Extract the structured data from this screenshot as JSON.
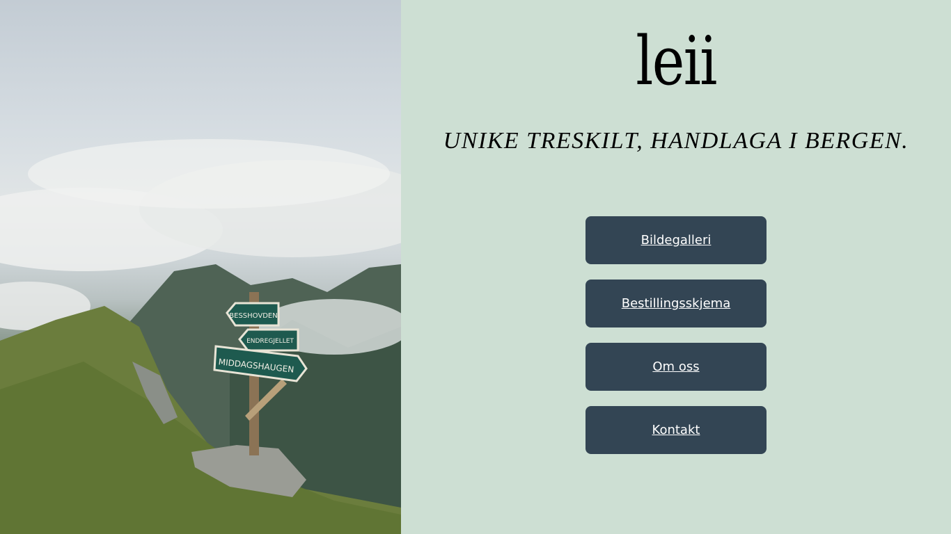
{
  "hero": {
    "sign_texts": [
      "BESSHOVDEN",
      "ENDREGJELLET",
      "MIDDAGSHAUGEN"
    ]
  },
  "brand": {
    "logo_text": "leii",
    "tagline": "UNIKE TRESKILT, HANDLAGA I BERGEN."
  },
  "nav": {
    "items": [
      {
        "label": "Bildegalleri"
      },
      {
        "label": "Bestillingsskjema"
      },
      {
        "label": "Om oss "
      },
      {
        "label": "Kontakt"
      }
    ]
  },
  "colors": {
    "panel_background": "#cddfd3",
    "button_background": "#334554",
    "button_text": "#ffffff",
    "sign_green": "#1e5a4f"
  }
}
